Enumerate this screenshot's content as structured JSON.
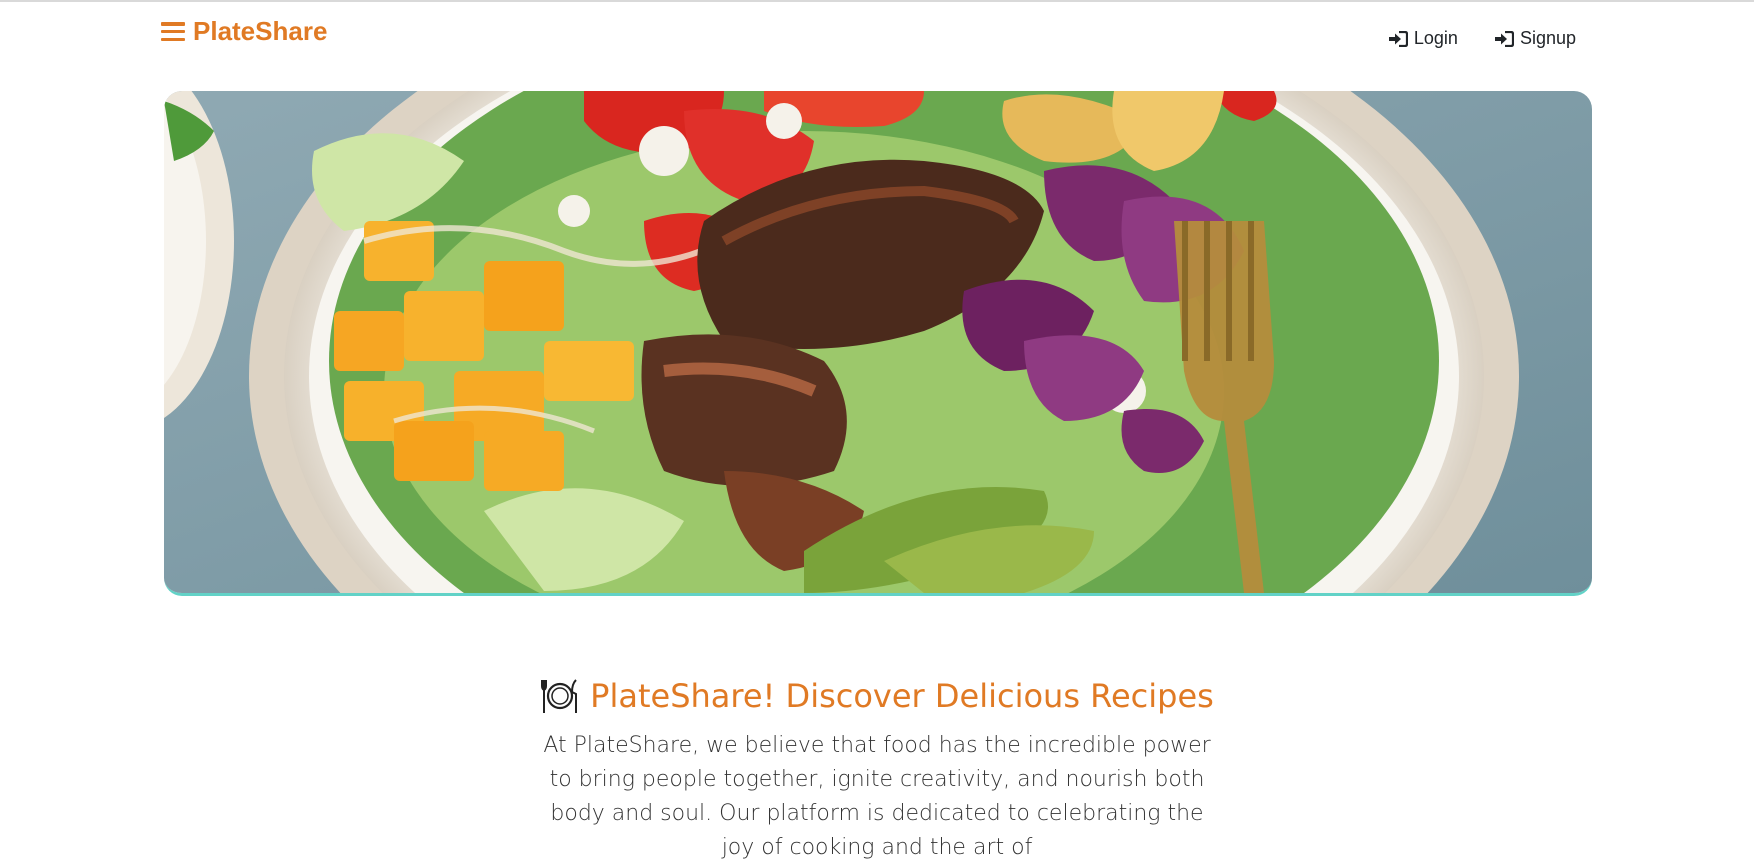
{
  "navbar": {
    "brand": "PlateShare",
    "links": [
      {
        "label": "Login",
        "icon": "sign-in-icon"
      },
      {
        "label": "Signup",
        "icon": "sign-in-icon"
      }
    ]
  },
  "hero": {
    "image": "salad-bowl-hero-image"
  },
  "intro": {
    "title": "PlateShare! Discover Delicious Recipes",
    "body": "At PlateShare, we believe that food has the incredible power to bring people together, ignite creativity, and nourish both body and soul. Our platform is dedicated to celebrating the joy of cooking and the art of"
  },
  "colors": {
    "accent": "#e07a24",
    "hero_border": "#62d2c7",
    "text": "#212529"
  }
}
